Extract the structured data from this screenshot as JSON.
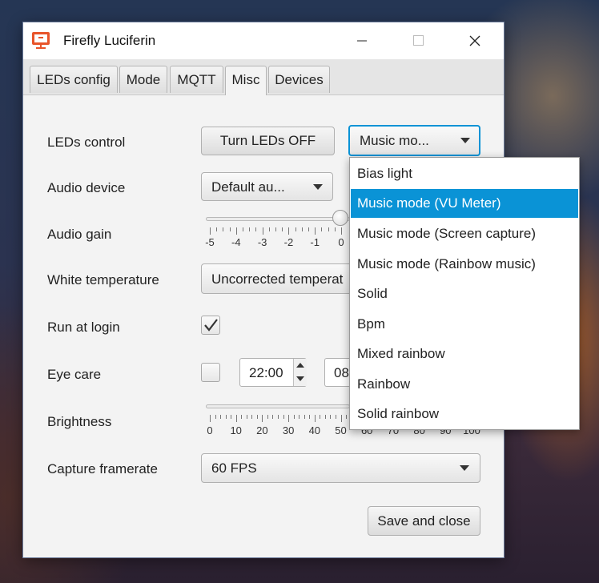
{
  "window": {
    "title": "Firefly Luciferin",
    "accent_color": "#e8542a"
  },
  "tabs": [
    {
      "label": "LEDs config"
    },
    {
      "label": "Mode"
    },
    {
      "label": "MQTT"
    },
    {
      "label": "Misc",
      "active": true
    },
    {
      "label": "Devices"
    }
  ],
  "form": {
    "leds_control": {
      "label": "LEDs control",
      "button": "Turn LEDs OFF",
      "mode_value": "Music mo..."
    },
    "audio_device": {
      "label": "Audio device",
      "value": "Default au..."
    },
    "audio_gain": {
      "label": "Audio gain",
      "ticks": [
        "-5",
        "-4",
        "-3",
        "-2",
        "-1",
        "0"
      ],
      "value": 0
    },
    "white_temperature": {
      "label": "White temperature",
      "value": "Uncorrected temperat"
    },
    "run_at_login": {
      "label": "Run at login",
      "checked": true
    },
    "eye_care": {
      "label": "Eye care",
      "checked": false,
      "from": "22:00",
      "to": "08"
    },
    "brightness": {
      "label": "Brightness",
      "ticks": [
        "0",
        "10",
        "20",
        "30",
        "40",
        "50",
        "60",
        "70",
        "80",
        "90",
        "100"
      ]
    },
    "capture_framerate": {
      "label": "Capture framerate",
      "value": "60 FPS"
    },
    "save_label": "Save and close"
  },
  "dropdown": {
    "options": [
      "Bias light",
      "Music mode (VU Meter)",
      "Music mode (Screen capture)",
      "Music mode (Rainbow music)",
      "Solid",
      "Bpm",
      "Mixed rainbow",
      "Rainbow",
      "Solid rainbow"
    ],
    "selected_index": 1,
    "selected_color": "#0a93d6"
  }
}
